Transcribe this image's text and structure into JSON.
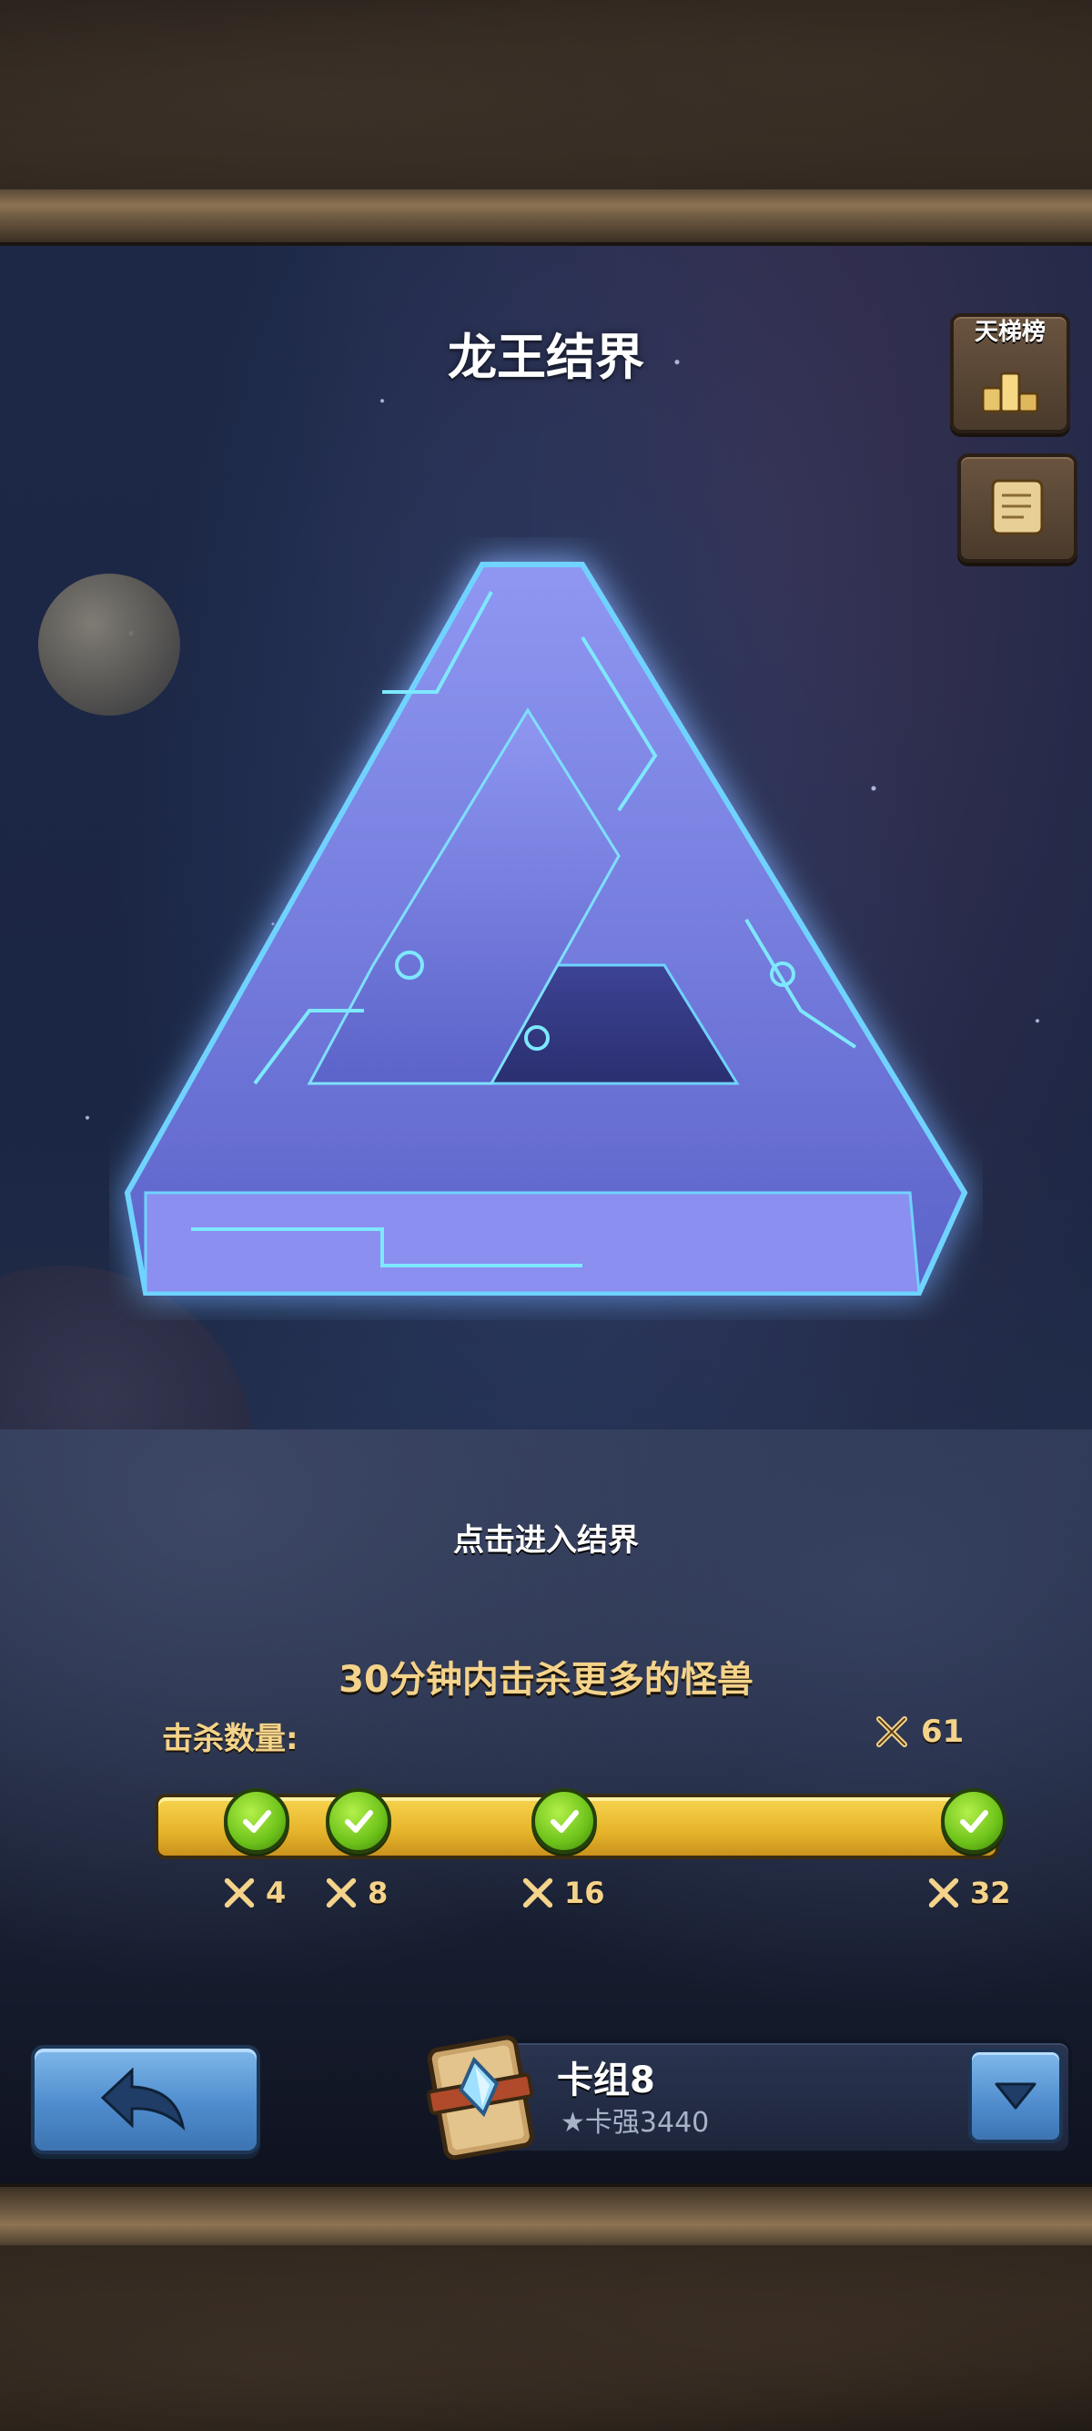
{
  "header": {
    "title": "龙王结界"
  },
  "side_buttons": {
    "ladder_label": "天梯榜"
  },
  "main": {
    "prompt": "点击进入结界",
    "objective": "30分钟内击杀更多的怪兽",
    "kill_label": "击杀数量:",
    "kill_count": "61",
    "progress": {
      "current": 61,
      "milestones": [
        "4",
        "8",
        "16",
        "32"
      ],
      "completed": [
        true,
        true,
        true,
        true
      ]
    }
  },
  "deck": {
    "name": "卡组8",
    "power": "★卡强3440"
  },
  "icons": {
    "ladder": "podium-icon",
    "scroll": "scroll-icon",
    "kills": "crossed-swords-icon",
    "check": "check-icon",
    "back": "back-arrow-icon",
    "deck": "card-deck-icon",
    "dropdown": "chevron-down-icon"
  },
  "colors": {
    "accent_gold": "#f4d38a",
    "bar_fill": "#e6b42a",
    "check_green": "#6cc21a",
    "button_blue": "#4f8ccd"
  }
}
